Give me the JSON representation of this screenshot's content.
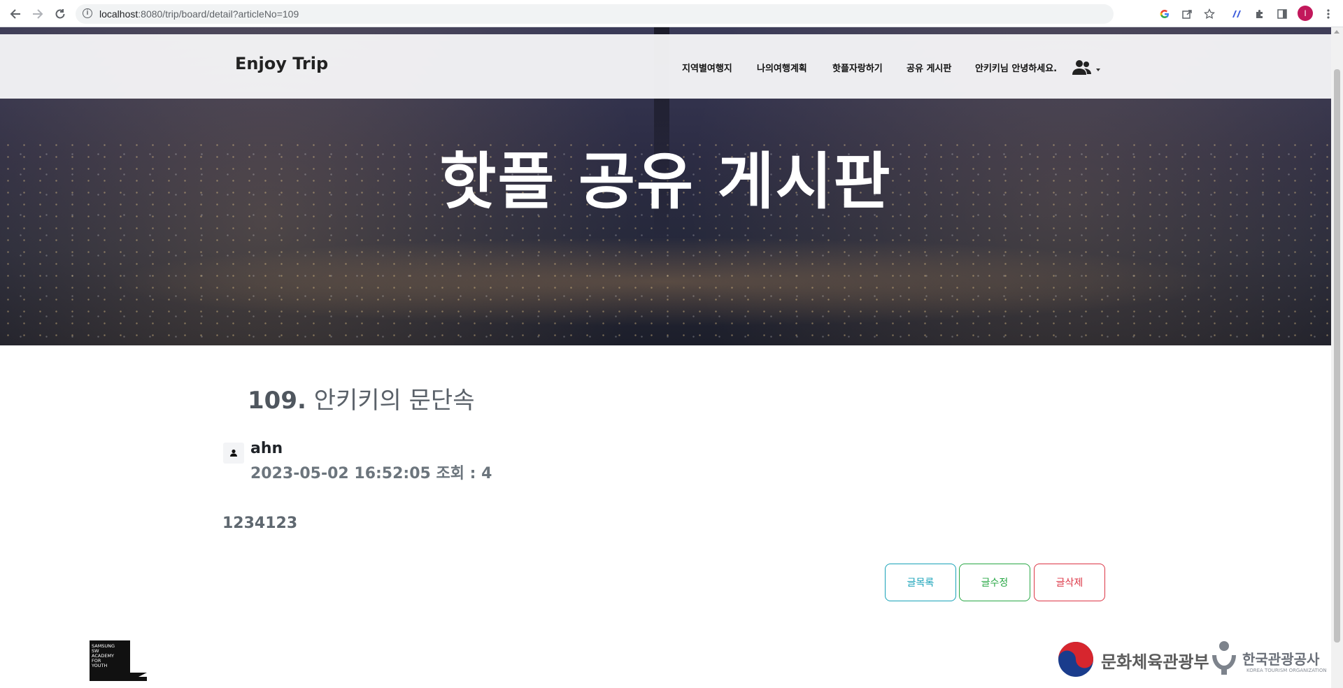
{
  "browser": {
    "url_host": "localhost",
    "url_rest": ":8080/trip/board/detail?articleNo=109",
    "profile_initial": "I",
    "icons": [
      "back-icon",
      "forward-icon",
      "reload-icon",
      "info-icon",
      "google-icon",
      "share-icon",
      "bookmark-star-icon",
      "extension-icon",
      "puzzle-icon",
      "sidepanel-icon",
      "profile-avatar",
      "menu-dots-icon"
    ]
  },
  "nav": {
    "brand": "Enjoy Trip",
    "items": [
      {
        "label": "지역별여행지"
      },
      {
        "label": "나의여행계획"
      },
      {
        "label": "핫플자랑하기"
      },
      {
        "label": "공유 게시판"
      },
      {
        "label": "안키키님 안녕하세요."
      }
    ],
    "user_menu_icon": "users-icon"
  },
  "hero": {
    "title": "핫플 공유 게시판"
  },
  "article": {
    "number": "109.",
    "subject": "안키키의 문단속",
    "author": "ahn",
    "meta": "2023-05-02 16:52:05 조회 : 4",
    "content": "1234123"
  },
  "buttons": {
    "list": "글목록",
    "edit": "글수정",
    "delete": "글삭제"
  },
  "footer": {
    "ssafy_lines": [
      "SAMSUNG",
      "SW",
      "ACADEMY",
      "FOR",
      "YOUTH"
    ],
    "moc_name": "문화체육관광부",
    "kto_name": "한국관광공사",
    "kto_sub": "KOREA TOURISM ORGANIZATION"
  },
  "colors": {
    "list_button": "#17a2b8",
    "edit_button": "#28a745",
    "delete_button": "#dc3545",
    "profile": "#c2185b"
  }
}
